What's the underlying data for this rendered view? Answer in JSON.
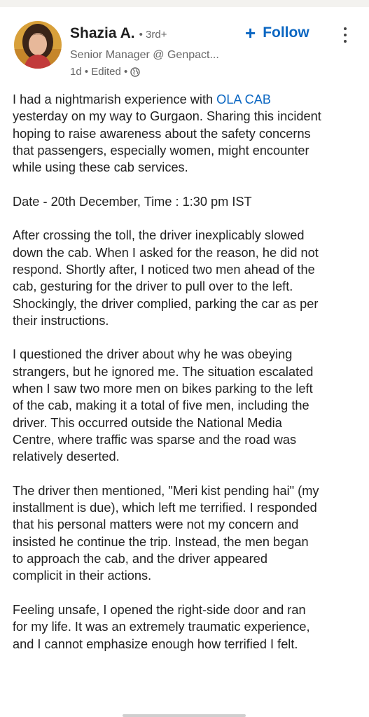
{
  "post": {
    "author": {
      "name": "Shazia A.",
      "degree": "• 3rd+",
      "headline": "Senior Manager @ Genpact...",
      "meta": "1d • Edited •"
    },
    "actions": {
      "follow_label": "Follow",
      "follow_icon": "plus-icon",
      "menu_icon": "more-vertical-icon"
    },
    "visibility_icon": "globe-icon",
    "accent_color": "#0a66c2",
    "body": {
      "p1": {
        "l1_pre": "I had a nightmarish experience with ",
        "l1_link": "OLA CAB",
        "l2": "yesterday on my way to Gurgaon. Sharing this incident",
        "l3": "hoping to raise awareness about the safety concerns",
        "l4": "that passengers, especially women, might encounter",
        "l5": "while using these cab services."
      },
      "p2": {
        "l1": "Date - 20th December, Time : 1:30 pm IST"
      },
      "p3": {
        "l1": "After crossing the toll, the driver inexplicably slowed",
        "l2": "down the cab. When I asked for the reason, he did not",
        "l3": "respond. Shortly after, I noticed two men ahead of the",
        "l4": "cab, gesturing for the driver to pull over to the left.",
        "l5": "Shockingly, the driver complied, parking the car as per",
        "l6": "their instructions."
      },
      "p4": {
        "l1": "I questioned the driver about why he was obeying",
        "l2": "strangers, but he ignored me. The situation escalated",
        "l3": "when I saw two more men on bikes parking to the left",
        "l4": "of the cab, making it a total of five men, including the",
        "l5": "driver. This occurred outside the National Media",
        "l6": "Centre, where traffic was sparse and the road was",
        "l7": "relatively deserted."
      },
      "p5": {
        "l1": "The driver then mentioned, \"Meri kist pending hai\" (my",
        "l2": "installment is due), which left me terrified. I responded",
        "l3": "that his personal matters were not my concern and",
        "l4": "insisted he continue the trip. Instead, the men began",
        "l5": "to approach the cab, and the driver appeared",
        "l6": "complicit in their actions."
      },
      "p6": {
        "l1": "Feeling unsafe, I opened the right-side door and ran",
        "l2": "for my life. It was an extremely traumatic experience,",
        "l3": "and I cannot emphasize enough how terrified I felt."
      }
    }
  }
}
